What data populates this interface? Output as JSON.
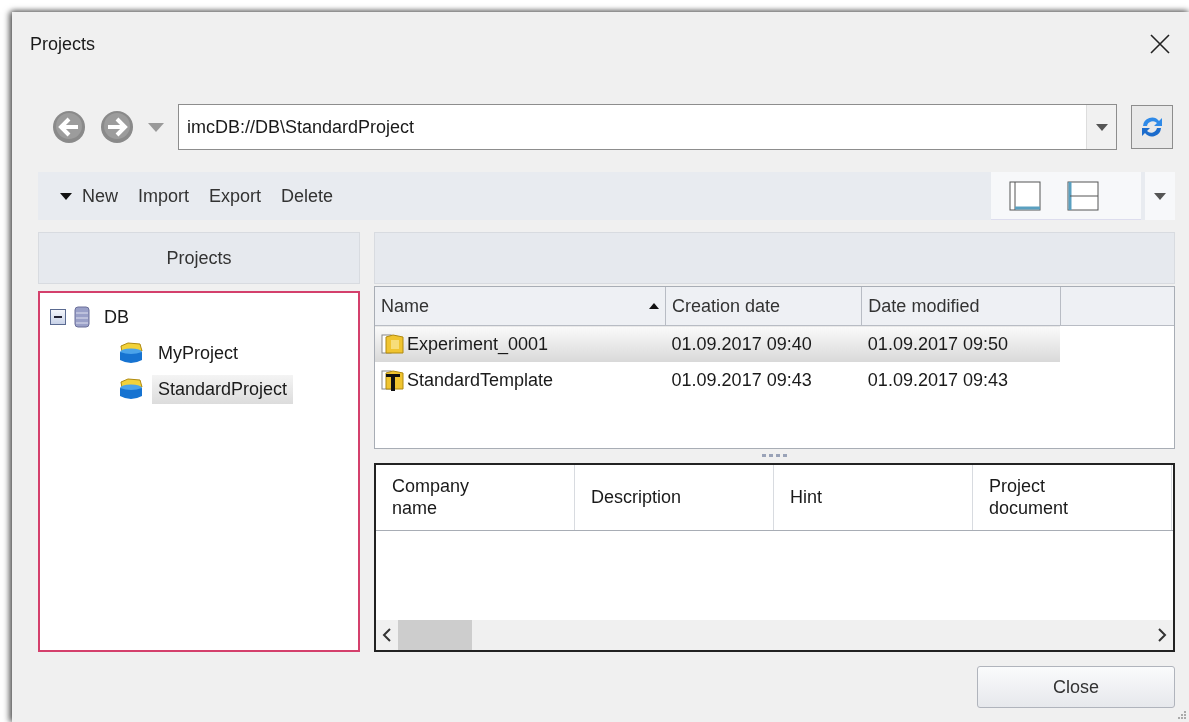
{
  "window": {
    "title": "Projects"
  },
  "address": {
    "value": "imcDB://DB\\StandardProject"
  },
  "toolbar": {
    "items": [
      {
        "label": "New",
        "kind": "dropdown"
      },
      {
        "label": "Import",
        "kind": "plain"
      },
      {
        "label": "Export",
        "kind": "plain"
      },
      {
        "label": "Delete",
        "kind": "plain"
      }
    ]
  },
  "sidebar": {
    "header": "Projects",
    "tree": [
      {
        "label": "DB",
        "kind": "database",
        "expanded": true,
        "selected": false,
        "children": [
          {
            "label": "MyProject",
            "kind": "project",
            "selected": false
          },
          {
            "label": "StandardProject",
            "kind": "project",
            "selected": true
          }
        ]
      }
    ]
  },
  "files": {
    "columns": [
      {
        "label": "Name",
        "sort_ascending": true
      },
      {
        "label": "Creation date"
      },
      {
        "label": "Date modified"
      }
    ],
    "rows": [
      {
        "kind": "experiment",
        "selected": true,
        "cells": [
          "Experiment_0001",
          "01.09.2017 09:40",
          "01.09.2017 09:50"
        ]
      },
      {
        "kind": "template",
        "selected": false,
        "cells": [
          "StandardTemplate",
          "01.09.2017 09:43",
          "01.09.2017 09:43"
        ]
      }
    ]
  },
  "details": {
    "columns": [
      "Company name",
      "Description",
      "Hint",
      "Project document"
    ]
  },
  "buttons": [
    {
      "label": "Close"
    }
  ]
}
